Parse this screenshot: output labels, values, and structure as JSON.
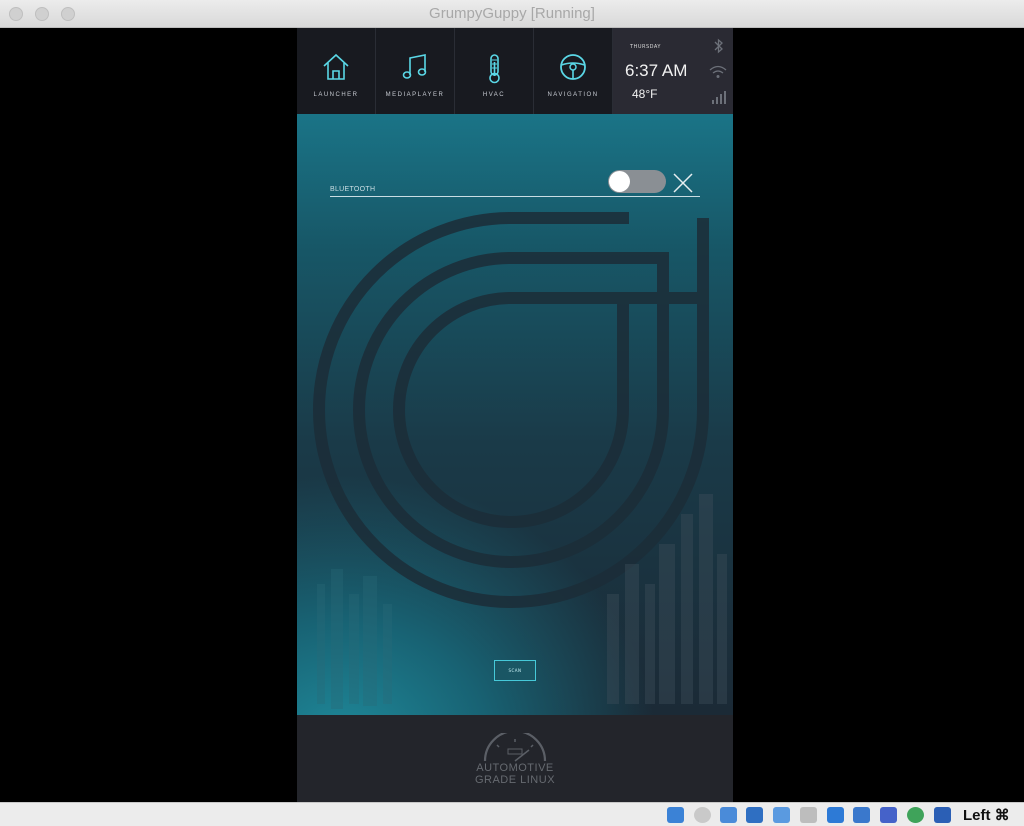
{
  "window": {
    "title": "GrumpyGuppy [Running]"
  },
  "nav": {
    "items": [
      {
        "label": "LAUNCHER",
        "icon": "home-icon"
      },
      {
        "label": "MEDIAPLAYER",
        "icon": "music-note-icon"
      },
      {
        "label": "HVAC",
        "icon": "thermometer-icon"
      },
      {
        "label": "NAVIGATION",
        "icon": "steering-wheel-icon"
      }
    ]
  },
  "status": {
    "day": "THURSDAY",
    "time": "6:37 AM",
    "temperature": "48°F"
  },
  "bluetooth": {
    "label": "BLUETOOTH",
    "toggle_on": false,
    "scan_label": "SCAN"
  },
  "logo": {
    "line1": "AUTOMOTIVE",
    "line2": "GRADE LINUX"
  },
  "statusbar": {
    "host_key": "Left ⌘"
  },
  "colors": {
    "accent": "#46c9d9",
    "panel_top": "#1a7487",
    "panel_bottom": "#1b2a36"
  }
}
